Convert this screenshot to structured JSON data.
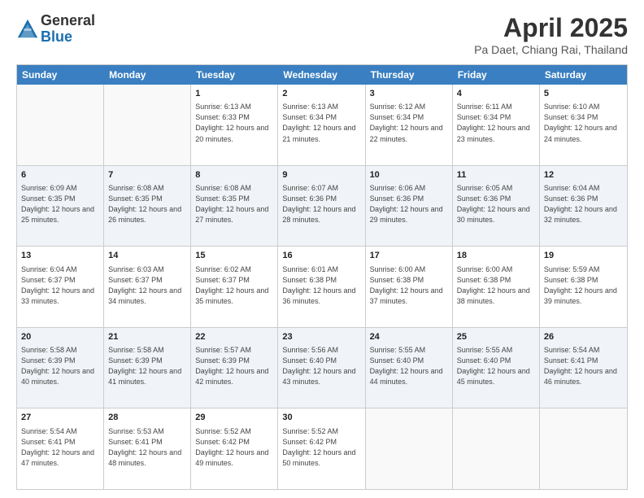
{
  "logo": {
    "general": "General",
    "blue": "Blue"
  },
  "title": "April 2025",
  "subtitle": "Pa Daet, Chiang Rai, Thailand",
  "days": [
    "Sunday",
    "Monday",
    "Tuesday",
    "Wednesday",
    "Thursday",
    "Friday",
    "Saturday"
  ],
  "rows": [
    [
      {
        "day": "",
        "sunrise": "",
        "sunset": "",
        "daylight": "",
        "empty": true
      },
      {
        "day": "",
        "sunrise": "",
        "sunset": "",
        "daylight": "",
        "empty": true
      },
      {
        "day": "1",
        "sunrise": "Sunrise: 6:13 AM",
        "sunset": "Sunset: 6:33 PM",
        "daylight": "Daylight: 12 hours and 20 minutes."
      },
      {
        "day": "2",
        "sunrise": "Sunrise: 6:13 AM",
        "sunset": "Sunset: 6:34 PM",
        "daylight": "Daylight: 12 hours and 21 minutes."
      },
      {
        "day": "3",
        "sunrise": "Sunrise: 6:12 AM",
        "sunset": "Sunset: 6:34 PM",
        "daylight": "Daylight: 12 hours and 22 minutes."
      },
      {
        "day": "4",
        "sunrise": "Sunrise: 6:11 AM",
        "sunset": "Sunset: 6:34 PM",
        "daylight": "Daylight: 12 hours and 23 minutes."
      },
      {
        "day": "5",
        "sunrise": "Sunrise: 6:10 AM",
        "sunset": "Sunset: 6:34 PM",
        "daylight": "Daylight: 12 hours and 24 minutes."
      }
    ],
    [
      {
        "day": "6",
        "sunrise": "Sunrise: 6:09 AM",
        "sunset": "Sunset: 6:35 PM",
        "daylight": "Daylight: 12 hours and 25 minutes."
      },
      {
        "day": "7",
        "sunrise": "Sunrise: 6:08 AM",
        "sunset": "Sunset: 6:35 PM",
        "daylight": "Daylight: 12 hours and 26 minutes."
      },
      {
        "day": "8",
        "sunrise": "Sunrise: 6:08 AM",
        "sunset": "Sunset: 6:35 PM",
        "daylight": "Daylight: 12 hours and 27 minutes."
      },
      {
        "day": "9",
        "sunrise": "Sunrise: 6:07 AM",
        "sunset": "Sunset: 6:36 PM",
        "daylight": "Daylight: 12 hours and 28 minutes."
      },
      {
        "day": "10",
        "sunrise": "Sunrise: 6:06 AM",
        "sunset": "Sunset: 6:36 PM",
        "daylight": "Daylight: 12 hours and 29 minutes."
      },
      {
        "day": "11",
        "sunrise": "Sunrise: 6:05 AM",
        "sunset": "Sunset: 6:36 PM",
        "daylight": "Daylight: 12 hours and 30 minutes."
      },
      {
        "day": "12",
        "sunrise": "Sunrise: 6:04 AM",
        "sunset": "Sunset: 6:36 PM",
        "daylight": "Daylight: 12 hours and 32 minutes."
      }
    ],
    [
      {
        "day": "13",
        "sunrise": "Sunrise: 6:04 AM",
        "sunset": "Sunset: 6:37 PM",
        "daylight": "Daylight: 12 hours and 33 minutes."
      },
      {
        "day": "14",
        "sunrise": "Sunrise: 6:03 AM",
        "sunset": "Sunset: 6:37 PM",
        "daylight": "Daylight: 12 hours and 34 minutes."
      },
      {
        "day": "15",
        "sunrise": "Sunrise: 6:02 AM",
        "sunset": "Sunset: 6:37 PM",
        "daylight": "Daylight: 12 hours and 35 minutes."
      },
      {
        "day": "16",
        "sunrise": "Sunrise: 6:01 AM",
        "sunset": "Sunset: 6:38 PM",
        "daylight": "Daylight: 12 hours and 36 minutes."
      },
      {
        "day": "17",
        "sunrise": "Sunrise: 6:00 AM",
        "sunset": "Sunset: 6:38 PM",
        "daylight": "Daylight: 12 hours and 37 minutes."
      },
      {
        "day": "18",
        "sunrise": "Sunrise: 6:00 AM",
        "sunset": "Sunset: 6:38 PM",
        "daylight": "Daylight: 12 hours and 38 minutes."
      },
      {
        "day": "19",
        "sunrise": "Sunrise: 5:59 AM",
        "sunset": "Sunset: 6:38 PM",
        "daylight": "Daylight: 12 hours and 39 minutes."
      }
    ],
    [
      {
        "day": "20",
        "sunrise": "Sunrise: 5:58 AM",
        "sunset": "Sunset: 6:39 PM",
        "daylight": "Daylight: 12 hours and 40 minutes."
      },
      {
        "day": "21",
        "sunrise": "Sunrise: 5:58 AM",
        "sunset": "Sunset: 6:39 PM",
        "daylight": "Daylight: 12 hours and 41 minutes."
      },
      {
        "day": "22",
        "sunrise": "Sunrise: 5:57 AM",
        "sunset": "Sunset: 6:39 PM",
        "daylight": "Daylight: 12 hours and 42 minutes."
      },
      {
        "day": "23",
        "sunrise": "Sunrise: 5:56 AM",
        "sunset": "Sunset: 6:40 PM",
        "daylight": "Daylight: 12 hours and 43 minutes."
      },
      {
        "day": "24",
        "sunrise": "Sunrise: 5:55 AM",
        "sunset": "Sunset: 6:40 PM",
        "daylight": "Daylight: 12 hours and 44 minutes."
      },
      {
        "day": "25",
        "sunrise": "Sunrise: 5:55 AM",
        "sunset": "Sunset: 6:40 PM",
        "daylight": "Daylight: 12 hours and 45 minutes."
      },
      {
        "day": "26",
        "sunrise": "Sunrise: 5:54 AM",
        "sunset": "Sunset: 6:41 PM",
        "daylight": "Daylight: 12 hours and 46 minutes."
      }
    ],
    [
      {
        "day": "27",
        "sunrise": "Sunrise: 5:54 AM",
        "sunset": "Sunset: 6:41 PM",
        "daylight": "Daylight: 12 hours and 47 minutes."
      },
      {
        "day": "28",
        "sunrise": "Sunrise: 5:53 AM",
        "sunset": "Sunset: 6:41 PM",
        "daylight": "Daylight: 12 hours and 48 minutes."
      },
      {
        "day": "29",
        "sunrise": "Sunrise: 5:52 AM",
        "sunset": "Sunset: 6:42 PM",
        "daylight": "Daylight: 12 hours and 49 minutes."
      },
      {
        "day": "30",
        "sunrise": "Sunrise: 5:52 AM",
        "sunset": "Sunset: 6:42 PM",
        "daylight": "Daylight: 12 hours and 50 minutes."
      },
      {
        "day": "",
        "sunrise": "",
        "sunset": "",
        "daylight": "",
        "empty": true
      },
      {
        "day": "",
        "sunrise": "",
        "sunset": "",
        "daylight": "",
        "empty": true
      },
      {
        "day": "",
        "sunrise": "",
        "sunset": "",
        "daylight": "",
        "empty": true
      }
    ]
  ]
}
